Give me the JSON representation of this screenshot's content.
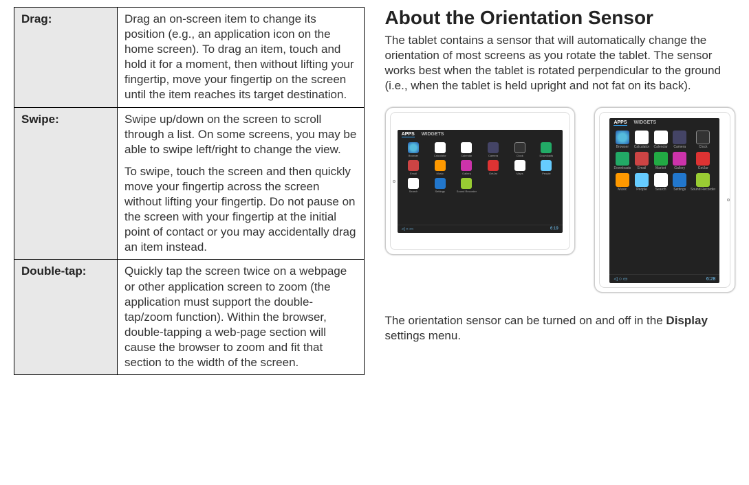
{
  "table": {
    "rows": [
      {
        "label": "Drag:",
        "body": "Drag an on-screen item to change its position (e.g., an application icon on the home screen).\nTo drag an item, touch and hold it for a moment, then without lifting your fingertip, move your fingertip on the screen until the item reaches its target destination."
      },
      {
        "label": "Swipe:",
        "body_paras": [
          "Swipe up/down on the screen to scroll through a list. On some screens, you may be able to swipe left/right to change the view.",
          "To swipe, touch the screen and then quickly move your fingertip across the screen without lifting your fingertip. Do not pause on the screen with your fingertip at the initial point of contact or you may accidentally drag an item instead."
        ]
      },
      {
        "label": "Double-tap:",
        "body": "Quickly tap the screen twice on a webpage or other application screen to zoom (the application must support the double-tap/zoom function). Within the browser, double-tapping a web-page section will cause the browser to zoom and fit that section to the width of the screen."
      }
    ]
  },
  "section": {
    "title": "About the Orientation Sensor",
    "intro": "The tablet contains a sensor that will automatically change the orientation of most screens as you rotate the tablet. The sensor works best when the tablet is rotated perpendicular to the ground (i.e., when the tablet is held upright and not fat on its back).",
    "outro_pre": "The orientation sensor can be turned on and off in the ",
    "outro_bold": "Display",
    "outro_post": " settings menu."
  },
  "tablet_ui": {
    "tabs": {
      "apps": "APPS",
      "widgets": "WIDGETS"
    },
    "status_time_landscape": "6:19",
    "status_time_portrait": "6:28",
    "nav_icons": "◁   ○   ▭",
    "apps_landscape": [
      {
        "n": "Browser",
        "c": "ic-globe"
      },
      {
        "n": "Calculator",
        "c": "ic-cal"
      },
      {
        "n": "Calendar",
        "c": "ic-cal"
      },
      {
        "n": "Camera",
        "c": "ic-cam"
      },
      {
        "n": "Clock",
        "c": "ic-clock"
      },
      {
        "n": "Downloads",
        "c": "ic-dl"
      },
      {
        "n": "Email",
        "c": "ic-mail"
      },
      {
        "n": "Music",
        "c": "ic-music"
      },
      {
        "n": "Gallery",
        "c": "ic-gal"
      },
      {
        "n": "GetJar",
        "c": "ic-g"
      },
      {
        "n": "Maps",
        "c": "ic-srch"
      },
      {
        "n": "People",
        "c": "ic-ppl"
      },
      {
        "n": "Search",
        "c": "ic-srch"
      },
      {
        "n": "Settings",
        "c": "ic-set"
      },
      {
        "n": "Sound Recorder",
        "c": "ic-and"
      }
    ],
    "apps_portrait": [
      {
        "n": "Browser",
        "c": "ic-globe"
      },
      {
        "n": "Calculator",
        "c": "ic-cal"
      },
      {
        "n": "Calendar",
        "c": "ic-cal"
      },
      {
        "n": "Camera",
        "c": "ic-cam"
      },
      {
        "n": "Clock",
        "c": "ic-clock"
      },
      {
        "n": "Downloads",
        "c": "ic-dl"
      },
      {
        "n": "Email",
        "c": "ic-mail"
      },
      {
        "n": "Market",
        "c": "ic-mkt"
      },
      {
        "n": "Gallery",
        "c": "ic-gal"
      },
      {
        "n": "GetJar",
        "c": "ic-g"
      },
      {
        "n": "Music",
        "c": "ic-music"
      },
      {
        "n": "People",
        "c": "ic-ppl"
      },
      {
        "n": "Search",
        "c": "ic-srch"
      },
      {
        "n": "Settings",
        "c": "ic-set"
      },
      {
        "n": "Sound Recorder",
        "c": "ic-and"
      }
    ]
  }
}
